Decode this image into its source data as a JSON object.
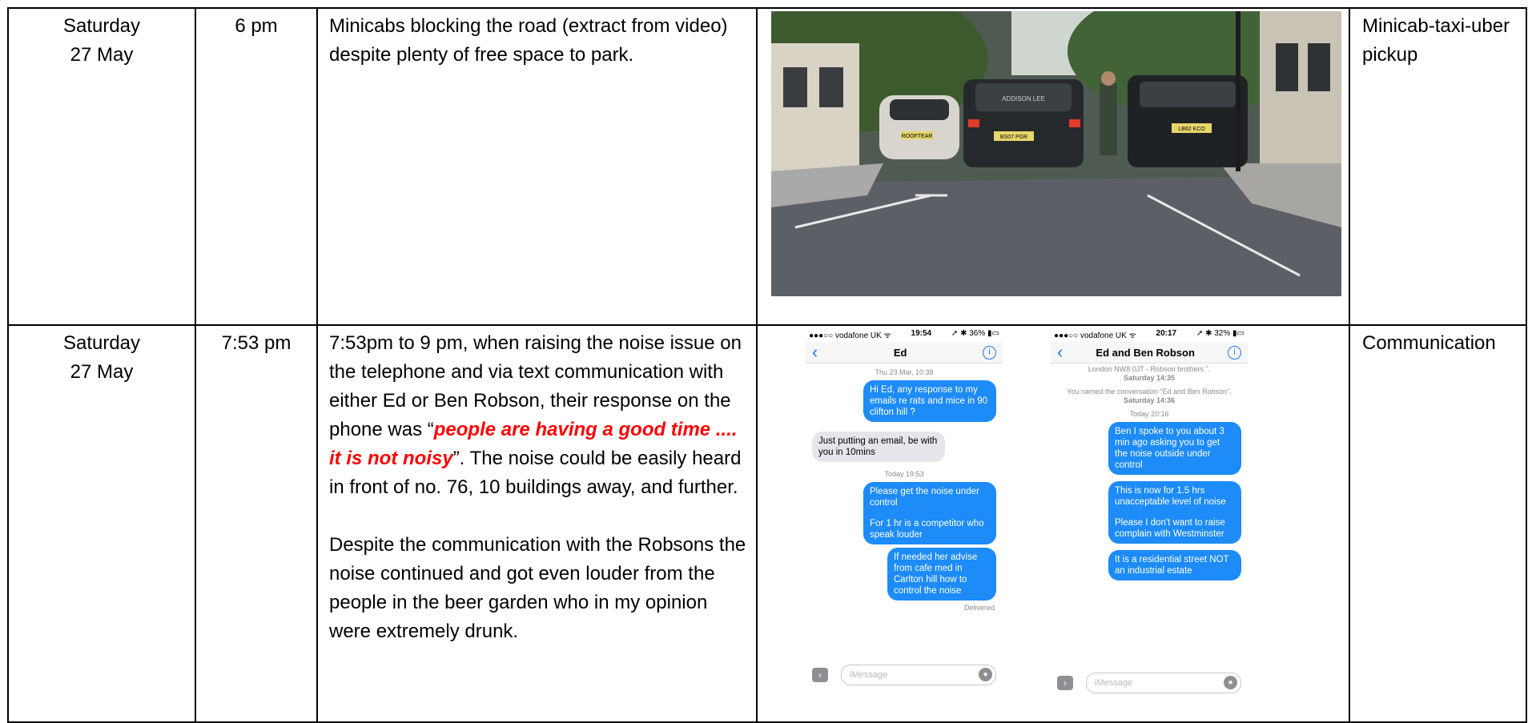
{
  "rows": [
    {
      "date": [
        "Saturday",
        "27 May"
      ],
      "time": "6 pm",
      "description": "Minicabs blocking the road (extract from video) despite plenty of free space to park.",
      "category": "Minicab-taxi-uber pickup",
      "photo": {
        "plates": [
          "ROOFTEAR",
          "BS07 PGR",
          "LB62 KCO"
        ],
        "sign_text": "ADDISON LEE"
      }
    },
    {
      "date": [
        "Saturday",
        "27 May"
      ],
      "time": "7:53 pm",
      "description_before": "7:53pm to 9 pm, when raising the noise issue on the telephone and via text communication with either Ed or Ben Robson, their response on the phone was “",
      "description_quote": "people are having a good time .... it is not noisy",
      "description_after": "”. The noise could be easily heard in front of no. 76, 10 buildings away, and further.",
      "description_para2": "Despite the communication with the Robsons the noise continued and got even louder from the people in the beer garden who in my opinion were extremely drunk.",
      "category": "Communication",
      "phone1": {
        "status_left": "●●●○○ vodafone UK ᯤ",
        "status_time": "19:54",
        "status_right": "➚ ✱ 36% ▮▭",
        "contact": "Ed",
        "stamp1": "Thu 23 Mar, 10:38",
        "msg1": "Hi Ed, any response to my emails re rats and mice in 90 clifton hill ?",
        "msg2": "Just putting an email, be with you in 10mins",
        "stamp2": "Today 19:53",
        "msg3a": "Please get the noise under control",
        "msg3b": "For 1 hr is a competitor who speak louder",
        "msg4": "If needed her advise from cafe med in Carlton hill how to control the noise",
        "delivered": "Delivered",
        "compose_placeholder": "iMessage"
      },
      "phone2": {
        "status_left": "●●●○○ vodafone UK ᯤ",
        "status_time": "20:17",
        "status_right": "➚ ✱ 32% ▮▭",
        "contact": "Ed and Ben Robson",
        "note1a": "London NW8 0JT - Robson brothers \".",
        "note1b": "Saturday 14:35",
        "note2a": "You named the conversation \"Ed and Ben Robson\".",
        "note2b": "Saturday 14:36",
        "stamp": "Today 20:16",
        "msg1": "Ben I spoke to you about 3 min ago asking you to get the noise outside under control",
        "msg2a": "This is now for 1.5 hrs unacceptable level of noise",
        "msg2b": "Please I don't want to raise complain with Westminster",
        "msg3": "It is a residential street NOT an industrial estate",
        "compose_placeholder": "iMessage"
      }
    }
  ]
}
